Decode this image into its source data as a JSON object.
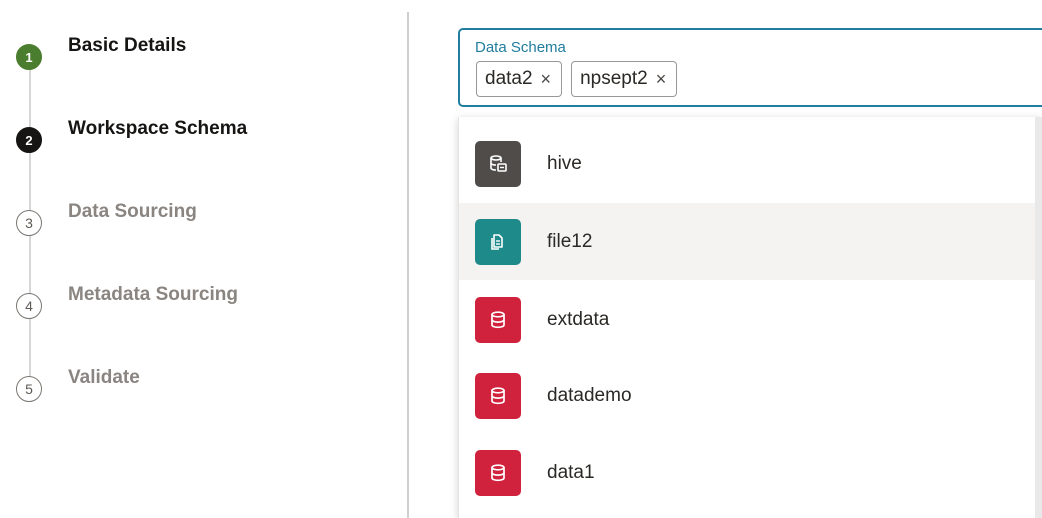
{
  "steps": [
    {
      "number": "1",
      "label": "Basic Details",
      "status": "completed"
    },
    {
      "number": "2",
      "label": "Workspace Schema",
      "status": "current"
    },
    {
      "number": "3",
      "label": "Data Sourcing",
      "status": "pending"
    },
    {
      "number": "4",
      "label": "Metadata Sourcing",
      "status": "pending"
    },
    {
      "number": "5",
      "label": "Validate",
      "status": "pending"
    }
  ],
  "schema_field": {
    "label": "Data Schema",
    "chips": [
      {
        "label": "data2",
        "close_icon": "×"
      },
      {
        "label": "npsept2",
        "close_icon": "×"
      }
    ]
  },
  "options": [
    {
      "label": "hive",
      "icon": "hive-database-icon",
      "color": "#4f4c4a"
    },
    {
      "label": "file12",
      "icon": "file-icon",
      "color": "#1f8a8a"
    },
    {
      "label": "extdata",
      "icon": "database-icon",
      "color": "#d0223d"
    },
    {
      "label": "datademo",
      "icon": "database-icon",
      "color": "#d0223d"
    },
    {
      "label": "data1",
      "icon": "database-icon",
      "color": "#d0223d"
    }
  ],
  "colors": {
    "accent": "#227e9e",
    "step_completed": "#4b7d2e",
    "step_current": "#161513"
  }
}
